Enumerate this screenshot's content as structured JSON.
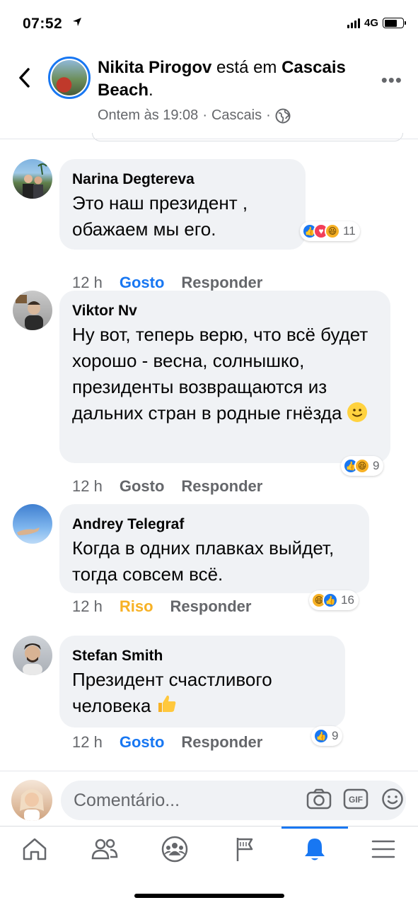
{
  "status_bar": {
    "time": "07:52",
    "network": "4G"
  },
  "post_header": {
    "author": "Nikita Pirogov",
    "connector": "está em",
    "place": "Cascais Beach",
    "suffix": ".",
    "timestamp": "Ontem às 19:08",
    "location": "Cascais",
    "separator": "·"
  },
  "comments": [
    {
      "name": "Narina Degtereva",
      "text": "Это наш президент , обажаем мы его.",
      "time": "12 h",
      "like_label": "Gosto",
      "like_state": "liked",
      "reply_label": "Responder",
      "reactions": [
        "like",
        "love",
        "haha"
      ],
      "reaction_count": "11"
    },
    {
      "name": "Viktor Nv",
      "text": "Ну вот, теперь верю, что всё будет хорошо - весна, солнышко, президенты возвращаются из дальних стран в родные гнёзда",
      "emoji": "slightly-smiling-face",
      "time": "12 h",
      "like_label": "Gosto",
      "like_state": "none",
      "reply_label": "Responder",
      "reactions": [
        "like",
        "haha"
      ],
      "reaction_count": "9"
    },
    {
      "name": "Andrey Telegraf",
      "text": "Когда в одних плавках выйдет, тогда совсем всё.",
      "time": "12 h",
      "like_label": "Riso",
      "like_state": "haha",
      "reply_label": "Responder",
      "reactions": [
        "haha",
        "like"
      ],
      "reaction_count": "16"
    },
    {
      "name": "Stefan Smith",
      "text": "Президент счастливого человека",
      "emoji": "thumbs-up",
      "time": "12 h",
      "like_label": "Gosto",
      "like_state": "liked",
      "reply_label": "Responder",
      "reactions": [
        "like"
      ],
      "reaction_count": "9"
    }
  ],
  "composer": {
    "placeholder": "Comentário..."
  },
  "tabs": [
    "home",
    "friends",
    "groups",
    "pages",
    "notifications",
    "menu"
  ],
  "active_tab": "notifications",
  "colors": {
    "accent": "#1877f2",
    "haha": "#f7b125",
    "bubble": "#f0f2f5",
    "muted": "#65676b"
  }
}
